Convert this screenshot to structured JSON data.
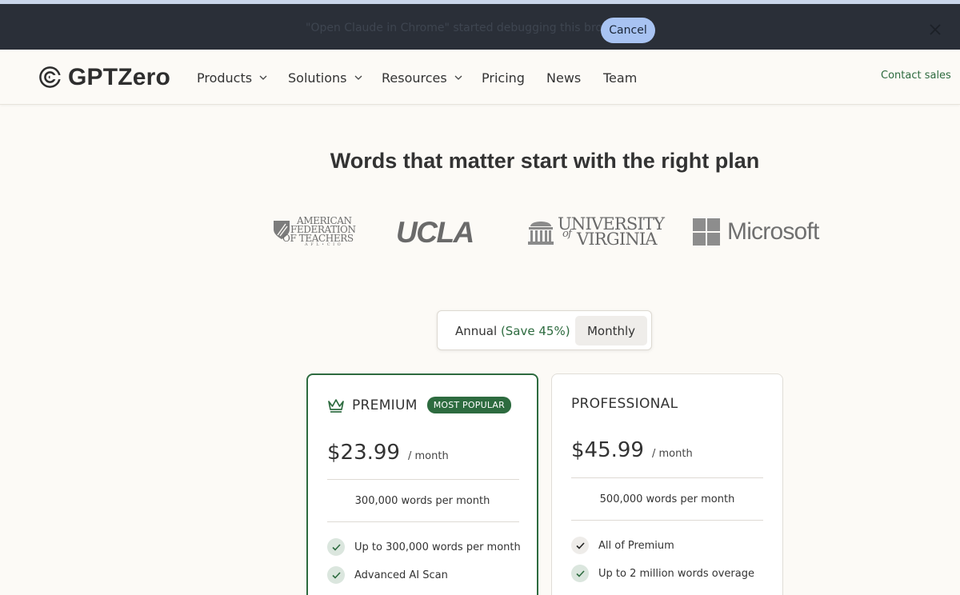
{
  "debug_banner": {
    "message": "\"Open Claude in Chrome\" started debugging this browser",
    "cancel_label": "Cancel"
  },
  "nav": {
    "logo_text": "GPTZero",
    "items": [
      {
        "label": "Products",
        "has_dropdown": true
      },
      {
        "label": "Solutions",
        "has_dropdown": true
      },
      {
        "label": "Resources",
        "has_dropdown": true
      },
      {
        "label": "Pricing",
        "has_dropdown": false
      },
      {
        "label": "News",
        "has_dropdown": false
      },
      {
        "label": "Team",
        "has_dropdown": false
      }
    ],
    "contact_sales": "Contact sales"
  },
  "headline": "Words that matter start with the right plan",
  "logos": {
    "aft": [
      "AMERICAN",
      "FEDERATION",
      "OF TEACHERS",
      "A F L • C I O"
    ],
    "ucla": "UCLA",
    "uva": [
      "UNIVERSITY",
      "of",
      "VIRGINIA"
    ],
    "microsoft": "Microsoft"
  },
  "billing_toggle": {
    "annual_label": "Annual",
    "annual_save": "(Save 45%)",
    "monthly_label": "Monthly",
    "selected": "Monthly"
  },
  "plans": [
    {
      "name": "PREMIUM",
      "badge": "MOST POPULAR",
      "price": "$23.99",
      "period": "/ month",
      "words": "300,000 words per month",
      "features": [
        "Up to 300,000 words per month",
        "Advanced AI Scan"
      ]
    },
    {
      "name": "PROFESSIONAL",
      "price": "$45.99",
      "period": "/ month",
      "words": "500,000 words per month",
      "features": [
        "All of Premium",
        "Up to 2 million words overage"
      ]
    }
  ],
  "colors": {
    "brand_green": "#2d6b3f",
    "debug_bar": "#2a2f38",
    "cancel_button": "#a8c3f2",
    "page_background": "#fcfaf6"
  }
}
